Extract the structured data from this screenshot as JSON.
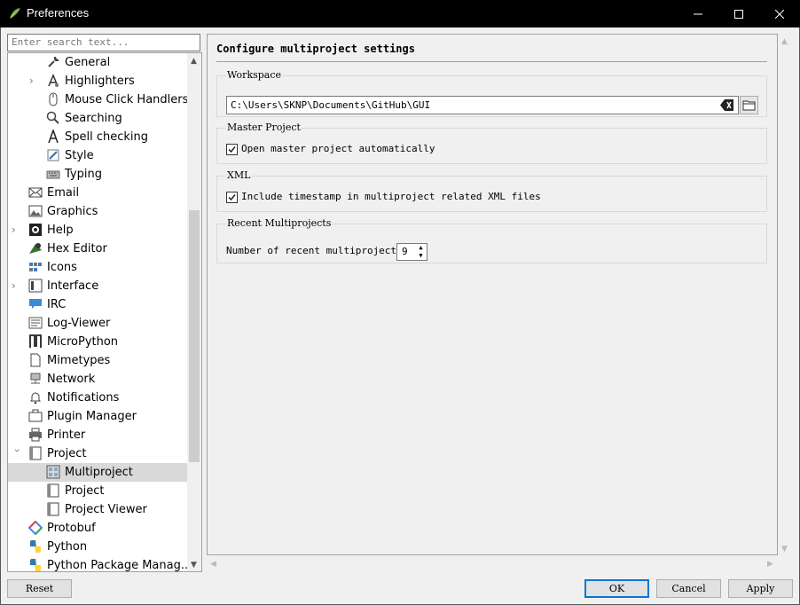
{
  "window": {
    "title": "Preferences"
  },
  "sidebar": {
    "filter_placeholder": "Enter search text...",
    "items": [
      {
        "label": "General",
        "icon": "wrench-icon"
      },
      {
        "label": "Highlighters",
        "icon": "highlighter-icon"
      },
      {
        "label": "Mouse Click Handlers",
        "icon": "mouse-icon"
      },
      {
        "label": "Searching",
        "icon": "magnifier-icon"
      },
      {
        "label": "Spell checking",
        "icon": "spell-icon"
      },
      {
        "label": "Style",
        "icon": "style-icon"
      },
      {
        "label": "Typing",
        "icon": "keyboard-icon"
      },
      {
        "label": "Email",
        "icon": "envelope-icon"
      },
      {
        "label": "Graphics",
        "icon": "image-icon"
      },
      {
        "label": "Help",
        "icon": "lifebuoy-icon"
      },
      {
        "label": "Hex Editor",
        "icon": "hex-editor-icon"
      },
      {
        "label": "Icons",
        "icon": "icons-icon"
      },
      {
        "label": "Interface",
        "icon": "interface-icon"
      },
      {
        "label": "IRC",
        "icon": "chat-icon"
      },
      {
        "label": "Log-Viewer",
        "icon": "log-icon"
      },
      {
        "label": "MicroPython",
        "icon": "micropython-icon"
      },
      {
        "label": "Mimetypes",
        "icon": "document-icon"
      },
      {
        "label": "Network",
        "icon": "network-icon"
      },
      {
        "label": "Notifications",
        "icon": "bell-icon"
      },
      {
        "label": "Plugin Manager",
        "icon": "plugin-icon"
      },
      {
        "label": "Printer",
        "icon": "printer-icon"
      },
      {
        "label": "Project",
        "icon": "project-icon"
      },
      {
        "label": "Multiproject",
        "icon": "multiproject-icon"
      },
      {
        "label": "Project",
        "icon": "project-icon"
      },
      {
        "label": "Project Viewer",
        "icon": "project-viewer-icon"
      },
      {
        "label": "Protobuf",
        "icon": "protobuf-icon"
      },
      {
        "label": "Python",
        "icon": "python-icon"
      },
      {
        "label": "Python Package Manag...",
        "icon": "python-icon"
      }
    ],
    "selected": "Multiproject"
  },
  "main": {
    "title": "Configure multiproject settings",
    "workspace": {
      "group_title": "Workspace",
      "path": "C:\\Users\\SKNP\\Documents\\GitHub\\GUI"
    },
    "master_project": {
      "group_title": "Master Project",
      "checkbox_label": "Open master project automatically",
      "checked": true
    },
    "xml": {
      "group_title": "XML",
      "checkbox_label": "Include timestamp in multiproject related XML files",
      "checked": true
    },
    "recent": {
      "group_title": "Recent Multiprojects",
      "label": "Number of recent multiprojects:",
      "value": "9"
    }
  },
  "buttons": {
    "reset": "Reset",
    "ok": "OK",
    "cancel": "Cancel",
    "apply": "Apply"
  }
}
